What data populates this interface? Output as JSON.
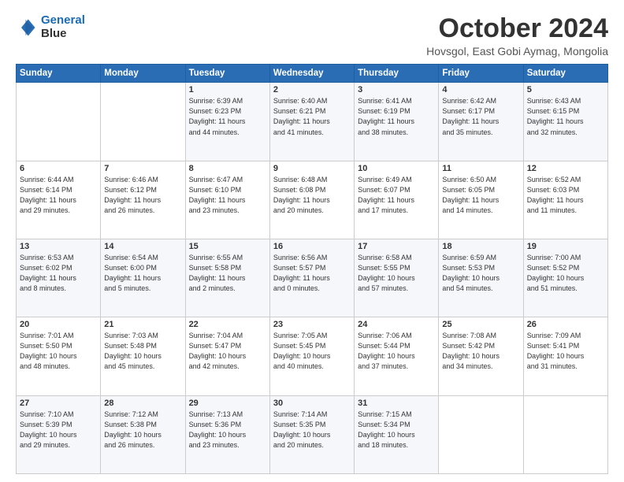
{
  "header": {
    "logo_line1": "General",
    "logo_line2": "Blue",
    "month": "October 2024",
    "location": "Hovsgol, East Gobi Aymag, Mongolia"
  },
  "weekdays": [
    "Sunday",
    "Monday",
    "Tuesday",
    "Wednesday",
    "Thursday",
    "Friday",
    "Saturday"
  ],
  "rows": [
    [
      {
        "day": "",
        "info": ""
      },
      {
        "day": "",
        "info": ""
      },
      {
        "day": "1",
        "info": "Sunrise: 6:39 AM\nSunset: 6:23 PM\nDaylight: 11 hours\nand 44 minutes."
      },
      {
        "day": "2",
        "info": "Sunrise: 6:40 AM\nSunset: 6:21 PM\nDaylight: 11 hours\nand 41 minutes."
      },
      {
        "day": "3",
        "info": "Sunrise: 6:41 AM\nSunset: 6:19 PM\nDaylight: 11 hours\nand 38 minutes."
      },
      {
        "day": "4",
        "info": "Sunrise: 6:42 AM\nSunset: 6:17 PM\nDaylight: 11 hours\nand 35 minutes."
      },
      {
        "day": "5",
        "info": "Sunrise: 6:43 AM\nSunset: 6:15 PM\nDaylight: 11 hours\nand 32 minutes."
      }
    ],
    [
      {
        "day": "6",
        "info": "Sunrise: 6:44 AM\nSunset: 6:14 PM\nDaylight: 11 hours\nand 29 minutes."
      },
      {
        "day": "7",
        "info": "Sunrise: 6:46 AM\nSunset: 6:12 PM\nDaylight: 11 hours\nand 26 minutes."
      },
      {
        "day": "8",
        "info": "Sunrise: 6:47 AM\nSunset: 6:10 PM\nDaylight: 11 hours\nand 23 minutes."
      },
      {
        "day": "9",
        "info": "Sunrise: 6:48 AM\nSunset: 6:08 PM\nDaylight: 11 hours\nand 20 minutes."
      },
      {
        "day": "10",
        "info": "Sunrise: 6:49 AM\nSunset: 6:07 PM\nDaylight: 11 hours\nand 17 minutes."
      },
      {
        "day": "11",
        "info": "Sunrise: 6:50 AM\nSunset: 6:05 PM\nDaylight: 11 hours\nand 14 minutes."
      },
      {
        "day": "12",
        "info": "Sunrise: 6:52 AM\nSunset: 6:03 PM\nDaylight: 11 hours\nand 11 minutes."
      }
    ],
    [
      {
        "day": "13",
        "info": "Sunrise: 6:53 AM\nSunset: 6:02 PM\nDaylight: 11 hours\nand 8 minutes."
      },
      {
        "day": "14",
        "info": "Sunrise: 6:54 AM\nSunset: 6:00 PM\nDaylight: 11 hours\nand 5 minutes."
      },
      {
        "day": "15",
        "info": "Sunrise: 6:55 AM\nSunset: 5:58 PM\nDaylight: 11 hours\nand 2 minutes."
      },
      {
        "day": "16",
        "info": "Sunrise: 6:56 AM\nSunset: 5:57 PM\nDaylight: 11 hours\nand 0 minutes."
      },
      {
        "day": "17",
        "info": "Sunrise: 6:58 AM\nSunset: 5:55 PM\nDaylight: 10 hours\nand 57 minutes."
      },
      {
        "day": "18",
        "info": "Sunrise: 6:59 AM\nSunset: 5:53 PM\nDaylight: 10 hours\nand 54 minutes."
      },
      {
        "day": "19",
        "info": "Sunrise: 7:00 AM\nSunset: 5:52 PM\nDaylight: 10 hours\nand 51 minutes."
      }
    ],
    [
      {
        "day": "20",
        "info": "Sunrise: 7:01 AM\nSunset: 5:50 PM\nDaylight: 10 hours\nand 48 minutes."
      },
      {
        "day": "21",
        "info": "Sunrise: 7:03 AM\nSunset: 5:48 PM\nDaylight: 10 hours\nand 45 minutes."
      },
      {
        "day": "22",
        "info": "Sunrise: 7:04 AM\nSunset: 5:47 PM\nDaylight: 10 hours\nand 42 minutes."
      },
      {
        "day": "23",
        "info": "Sunrise: 7:05 AM\nSunset: 5:45 PM\nDaylight: 10 hours\nand 40 minutes."
      },
      {
        "day": "24",
        "info": "Sunrise: 7:06 AM\nSunset: 5:44 PM\nDaylight: 10 hours\nand 37 minutes."
      },
      {
        "day": "25",
        "info": "Sunrise: 7:08 AM\nSunset: 5:42 PM\nDaylight: 10 hours\nand 34 minutes."
      },
      {
        "day": "26",
        "info": "Sunrise: 7:09 AM\nSunset: 5:41 PM\nDaylight: 10 hours\nand 31 minutes."
      }
    ],
    [
      {
        "day": "27",
        "info": "Sunrise: 7:10 AM\nSunset: 5:39 PM\nDaylight: 10 hours\nand 29 minutes."
      },
      {
        "day": "28",
        "info": "Sunrise: 7:12 AM\nSunset: 5:38 PM\nDaylight: 10 hours\nand 26 minutes."
      },
      {
        "day": "29",
        "info": "Sunrise: 7:13 AM\nSunset: 5:36 PM\nDaylight: 10 hours\nand 23 minutes."
      },
      {
        "day": "30",
        "info": "Sunrise: 7:14 AM\nSunset: 5:35 PM\nDaylight: 10 hours\nand 20 minutes."
      },
      {
        "day": "31",
        "info": "Sunrise: 7:15 AM\nSunset: 5:34 PM\nDaylight: 10 hours\nand 18 minutes."
      },
      {
        "day": "",
        "info": ""
      },
      {
        "day": "",
        "info": ""
      }
    ]
  ]
}
